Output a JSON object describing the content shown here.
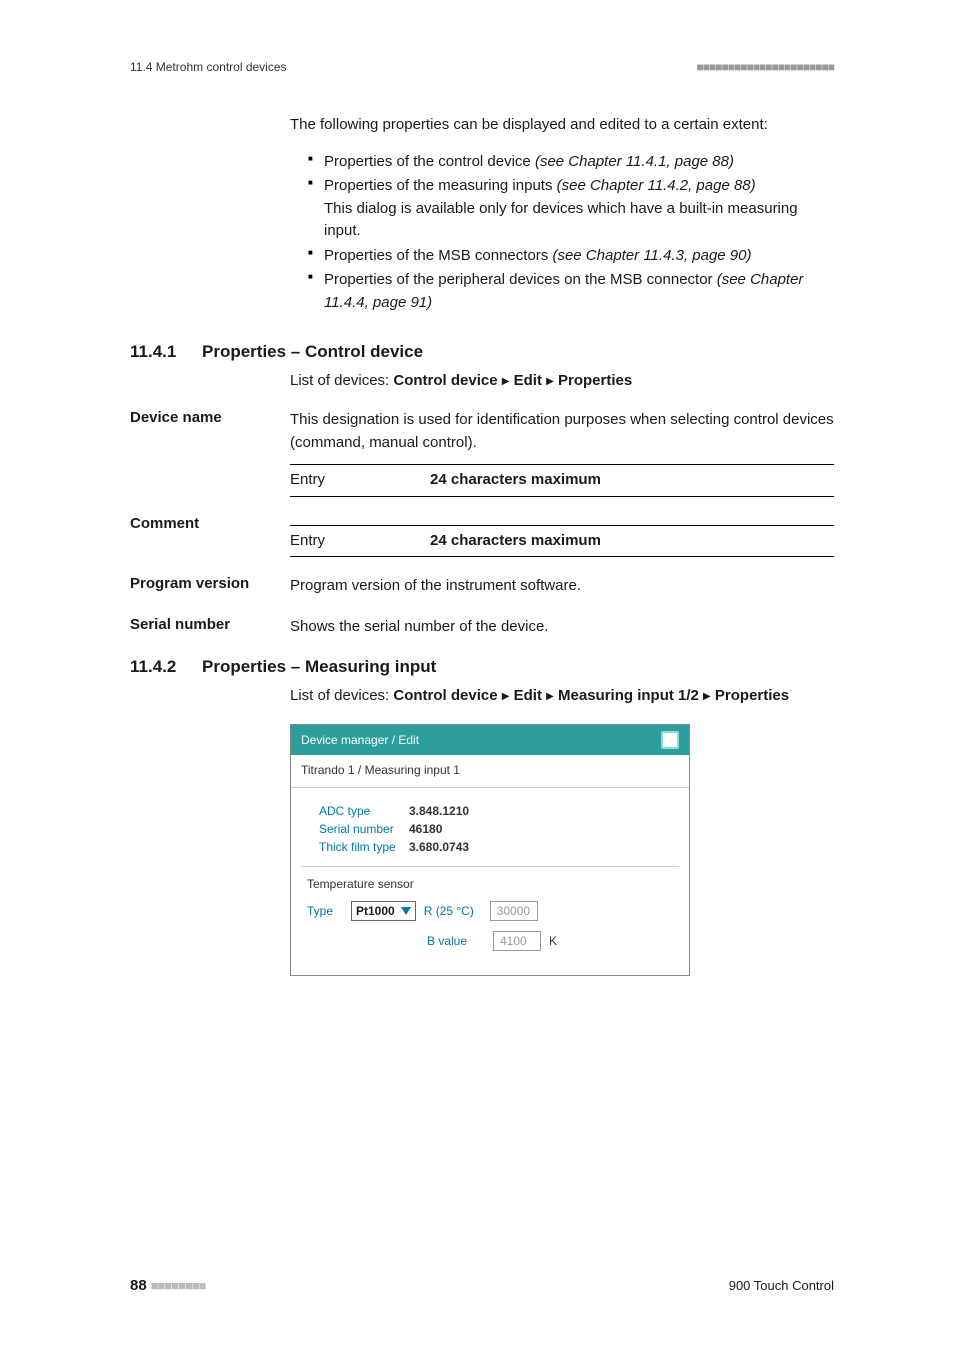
{
  "header": {
    "left": "11.4 Metrohm control devices",
    "right_dashes": "■■■■■■■■■■■■■■■■■■■■■■"
  },
  "intro": "The following properties can be displayed and edited to a certain extent:",
  "bullets": [
    {
      "text": "Properties of the control device ",
      "ref": "(see Chapter 11.4.1, page 88)",
      "extra": ""
    },
    {
      "text": "Properties of the measuring inputs ",
      "ref": "(see Chapter 11.4.2, page 88)",
      "extra": "This dialog is available only for devices which have a built-in measuring input."
    },
    {
      "text": "Properties of the MSB connectors ",
      "ref": "(see Chapter 11.4.3, page 90)",
      "extra": ""
    },
    {
      "text": "Properties of the peripheral devices on the MSB connector ",
      "ref": "(see Chapter 11.4.4, page 91)",
      "extra": ""
    }
  ],
  "s1": {
    "num": "11.4.1",
    "title": "Properties – Control device",
    "bc_prefix": "List of devices: ",
    "bc_a": "Control device",
    "bc_b": "Edit",
    "bc_c": "Properties"
  },
  "dev_name": {
    "label": "Device name",
    "desc": "This designation is used for identification purposes when selecting control devices (command, manual control).",
    "entry_label": "Entry",
    "entry_value": "24 characters maximum"
  },
  "comment": {
    "label": "Comment",
    "entry_label": "Entry",
    "entry_value": "24 characters maximum"
  },
  "prog_ver": {
    "label": "Program version",
    "desc": "Program version of the instrument software."
  },
  "serial": {
    "label": "Serial number",
    "desc": "Shows the serial number of the device."
  },
  "s2": {
    "num": "11.4.2",
    "title": "Properties – Measuring input",
    "bc_prefix": "List of devices: ",
    "bc_a": "Control device",
    "bc_b": "Edit",
    "bc_c": "Measuring input 1/2",
    "bc_d": "Properties"
  },
  "dialog": {
    "title": "Device manager / Edit",
    "subtitle": "Titrando 1 / Measuring input 1",
    "rows": [
      {
        "lab": "ADC type",
        "val": "3.848.1210"
      },
      {
        "lab": "Serial number",
        "val": "46180"
      },
      {
        "lab": "Thick film type",
        "val": "3.680.0743"
      }
    ],
    "temp_title": "Temperature sensor",
    "type_lab": "Type",
    "type_val": "Pt1000",
    "r_lab": "R (25 °C)",
    "r_val": "30000",
    "b_lab": "B value",
    "b_val": "4100",
    "b_unit": "K"
  },
  "footer": {
    "page": "88",
    "dashes": "■■■■■■■■",
    "product": "900 Touch Control"
  }
}
